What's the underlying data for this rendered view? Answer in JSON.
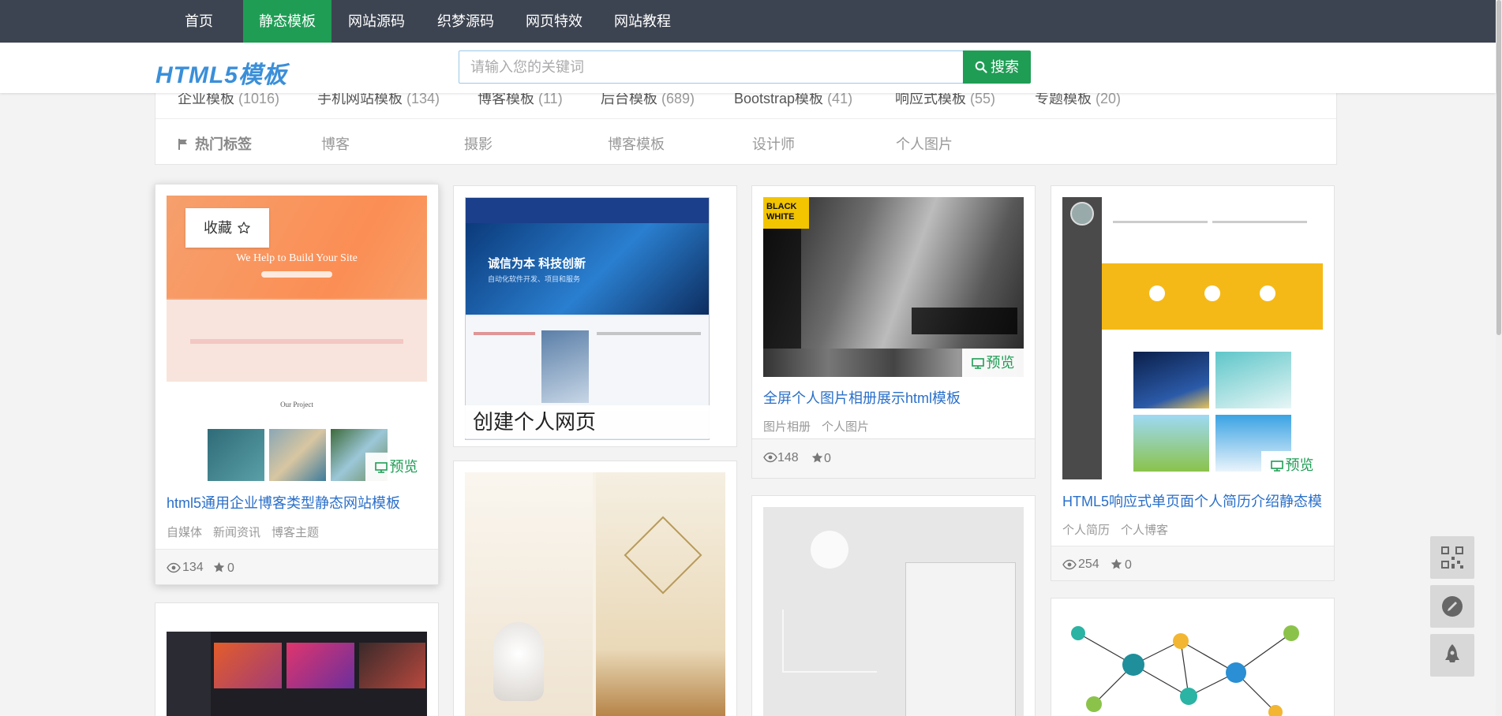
{
  "nav": {
    "items": [
      {
        "label": "首页"
      },
      {
        "label": "静态模板",
        "active": true
      },
      {
        "label": "网站源码"
      },
      {
        "label": "织梦源码"
      },
      {
        "label": "网页特效"
      },
      {
        "label": "网站教程"
      }
    ]
  },
  "header": {
    "logo": "HTML5模板",
    "search_placeholder": "请输入您的关键词",
    "search_button": "搜索"
  },
  "categories": [
    {
      "name": "企业模板",
      "count": "(1016)"
    },
    {
      "name": "手机网站模板",
      "count": "(134)"
    },
    {
      "name": "博客模板",
      "count": "(11)"
    },
    {
      "name": "后台模板",
      "count": "(689)"
    },
    {
      "name": "Bootstrap模板",
      "count": "(41)"
    },
    {
      "name": "响应式模板",
      "count": "(55)"
    },
    {
      "name": "专题模板",
      "count": "(20)"
    }
  ],
  "hot_tags": {
    "title": "热门标签",
    "tags": [
      "博客",
      "摄影",
      "博客模板",
      "设计师",
      "个人图片"
    ]
  },
  "cards": [
    {
      "title": "html5通用企业博客类型静态网站模板",
      "tags": [
        "自媒体",
        "新闻资讯",
        "博客主题"
      ],
      "views": "134",
      "stars": "0",
      "favorite_label": "收藏",
      "preview_label": "预览",
      "thumb_text": {
        "hero": "We Help to Build Your Site",
        "project": "Our Project"
      }
    },
    {
      "overlay_title": "创建个人网页",
      "thumb_text": {
        "slogan": "诚信为本 科技创新",
        "sub": "自动化软件开发、项目和服务"
      }
    },
    {
      "title": "全屏个人图片相册展示html模板",
      "tags": [
        "图片相册",
        "个人图片"
      ],
      "views": "148",
      "stars": "0",
      "preview_label": "预览",
      "thumb_text": {
        "brand": "BLACK WHITE"
      }
    },
    {
      "title": "HTML5响应式单页面个人简历介绍静态模",
      "tags": [
        "个人简历",
        "个人博客"
      ],
      "views": "254",
      "stars": "0",
      "preview_label": "预览"
    }
  ],
  "colors": {
    "nav_bg": "#3d4451",
    "accent_green": "#1f9d55",
    "link_blue": "#2a6fc9",
    "logo_blue": "#3a8fd9"
  },
  "side_buttons": [
    "qrcode-icon",
    "feedback-icon",
    "rocket-icon"
  ]
}
